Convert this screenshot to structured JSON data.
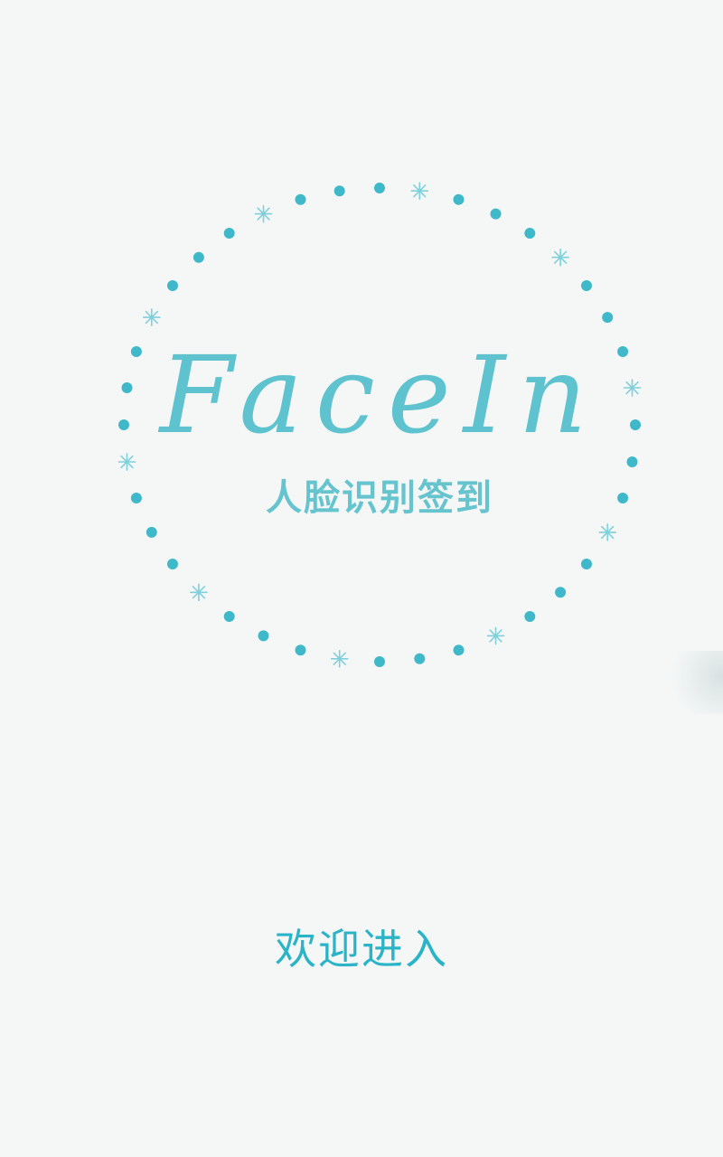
{
  "splash": {
    "logo": {
      "title": "FaceIn",
      "subtitle": "人脸识别签到"
    },
    "welcome_text": "欢迎进入"
  },
  "colors": {
    "background": "#f5f7f7",
    "accent": "#2bb4c8",
    "logo_title": "#5ec3cf",
    "logo_subtitle": "#65c4cd"
  },
  "icons": [
    "dotted-ring-icon",
    "sparkle-icon"
  ]
}
